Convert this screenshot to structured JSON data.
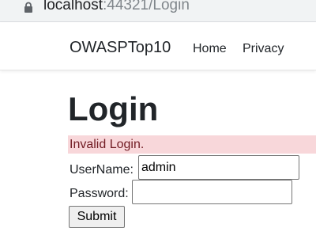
{
  "browser": {
    "url_host": "localhost",
    "url_rest": ":44321/Login",
    "lock_icon": "lock-icon"
  },
  "navbar": {
    "brand": "OWASPTop10",
    "links": [
      {
        "label": "Home"
      },
      {
        "label": "Privacy"
      }
    ]
  },
  "main": {
    "title": "Login",
    "error_message": "Invalid Login.",
    "username_label": "UserName:",
    "username_value": "admin",
    "password_label": "Password:",
    "password_value": "",
    "submit_label": "Submit"
  },
  "colors": {
    "error_background": "#f8d7da",
    "error_text": "#721c24"
  }
}
